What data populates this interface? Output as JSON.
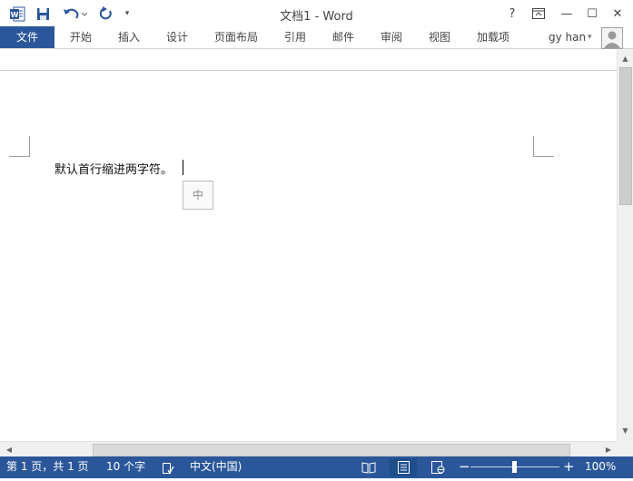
{
  "titlebar": {
    "title": "文档1 - Word",
    "help": "?",
    "minimize": "—",
    "maximize": "☐",
    "close": "✕"
  },
  "quick_access": {
    "icons": [
      "word-logo-icon",
      "save-icon",
      "undo-icon",
      "redo-icon",
      "customize-toolbar-icon"
    ]
  },
  "ribbon": {
    "tabs": [
      "文件",
      "开始",
      "插入",
      "设计",
      "页面布局",
      "引用",
      "邮件",
      "审阅",
      "视图",
      "加载项"
    ],
    "user_name": "gy han"
  },
  "document": {
    "text": "默认首行缩进两字符。",
    "ime_indicator": "中"
  },
  "statusbar": {
    "page_info": "第 1 页，共 1 页",
    "word_count": "10 个字",
    "language": "中文(中国)",
    "zoom_out": "−",
    "zoom_in": "+",
    "zoom_level": "100%",
    "zoom_percent": 100
  },
  "colors": {
    "accent": "#2b579a",
    "status_bar": "#2b579a",
    "file_tab": "#2b579a"
  }
}
